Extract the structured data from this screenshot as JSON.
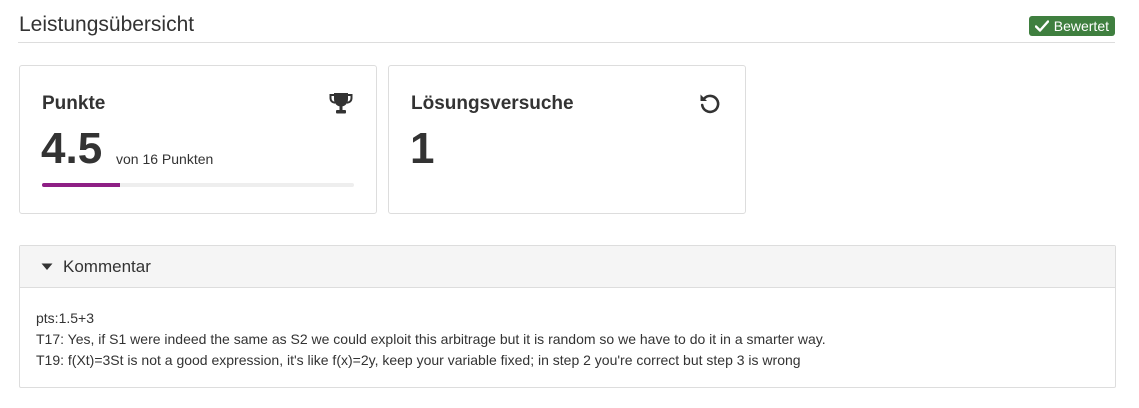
{
  "header": {
    "title": "Leistungsübersicht",
    "status_badge": "Bewertet",
    "status_color": "#3f7f3f"
  },
  "cards": {
    "points": {
      "title": "Punkte",
      "icon": "trophy-icon",
      "value": "4.5",
      "subvalue": "von 16 Punkten",
      "progress_fraction": 0.25,
      "progress_color": "#8e1f85"
    },
    "attempts": {
      "title": "Lösungsversuche",
      "icon": "retry-icon",
      "value": "1"
    }
  },
  "comment": {
    "header": "Kommentar",
    "expanded": true,
    "lines": [
      "pts:1.5+3",
      "T17: Yes, if S1 were indeed the same as S2 we could exploit this arbitrage but it is random so we have to do it in a smarter way.",
      "T19: f(Xt)=3St is not a good expression, it's like f(x)=2y, keep your variable fixed; in step 2 you're correct but step 3 is wrong"
    ]
  }
}
